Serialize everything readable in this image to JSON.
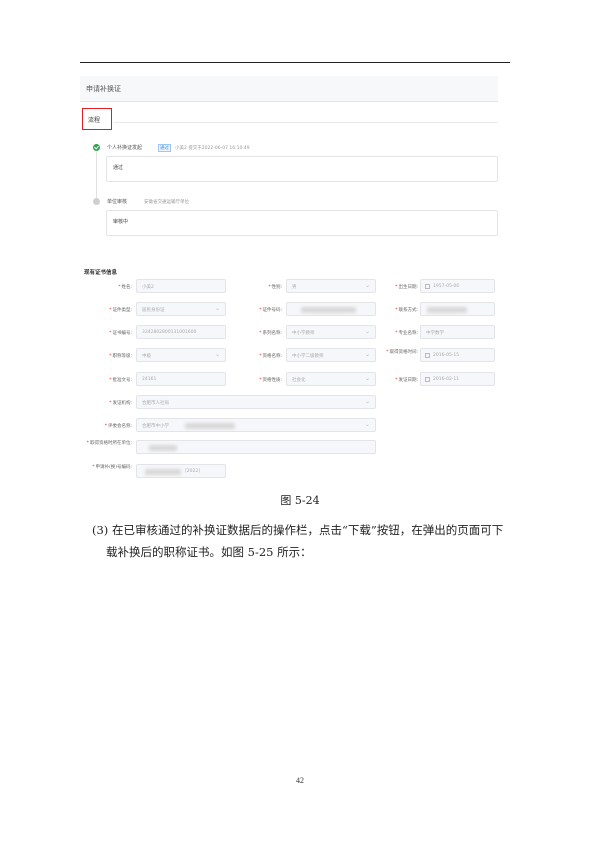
{
  "screenshot": {
    "header_title": "申请补换证",
    "flow_tab": "流程",
    "steps": [
      {
        "title": "个人补换证发起",
        "tag": "通过",
        "meta": "小美2 提交于2022-06-07 16:10:49",
        "status": "通过",
        "state": "done"
      },
      {
        "title": "单位审核",
        "meta": "安徽省交通运输厅单位",
        "status": "审核中",
        "state": "pending"
      }
    ],
    "section_title": "现有证书信息",
    "fields": [
      {
        "label": "姓名:",
        "value": "小美2",
        "type": "text"
      },
      {
        "label": "性别:",
        "value": "男",
        "type": "select"
      },
      {
        "label": "出生日期:",
        "value": "1957-05-06",
        "type": "date"
      },
      {
        "label": "证件类型:",
        "value": "居民身份证",
        "type": "select"
      },
      {
        "label": "证件号码:",
        "value": "",
        "type": "blurred"
      },
      {
        "label": "联系方式:",
        "value": "",
        "type": "blurred"
      },
      {
        "label": "证书编号:",
        "value": "3342802800131001600",
        "type": "text"
      },
      {
        "label": "系列名称:",
        "value": "中小学教师",
        "type": "select"
      },
      {
        "label": "专业名称:",
        "value": "中学数学",
        "type": "text"
      },
      {
        "label": "职称等级:",
        "value": "中级",
        "type": "select"
      },
      {
        "label": "资格名称:",
        "value": "中小学二级教师",
        "type": "select"
      },
      {
        "label": "取得资格时间:",
        "value": "2016-05-15",
        "type": "date"
      },
      {
        "label": "批准文号:",
        "value": "24161",
        "type": "text"
      },
      {
        "label": "资格性质:",
        "value": "社会化",
        "type": "select"
      },
      {
        "label": "发证日期:",
        "value": "2016-02-11",
        "type": "date"
      },
      {
        "label": "发证机构:",
        "value": "合肥市人社局",
        "type": "select"
      },
      {
        "label": "评委会名称:",
        "value": "合肥市中小学",
        "type": "select"
      },
      {
        "label": "取得资格时所在单位:",
        "value": "",
        "type": "blurred"
      },
      {
        "label": "申请补(换)号编码:",
        "value": "[2022]",
        "type": "text"
      }
    ]
  },
  "document": {
    "figure_caption": "图 5-24",
    "paragraph_line1": "(3) 在已审核通过的补换证数据后的操作栏，点击“下载”按钮，在弹出的页面可下",
    "paragraph_line2": "载补换后的职称证书。如图 5-25 所示：",
    "page_number": "42"
  }
}
